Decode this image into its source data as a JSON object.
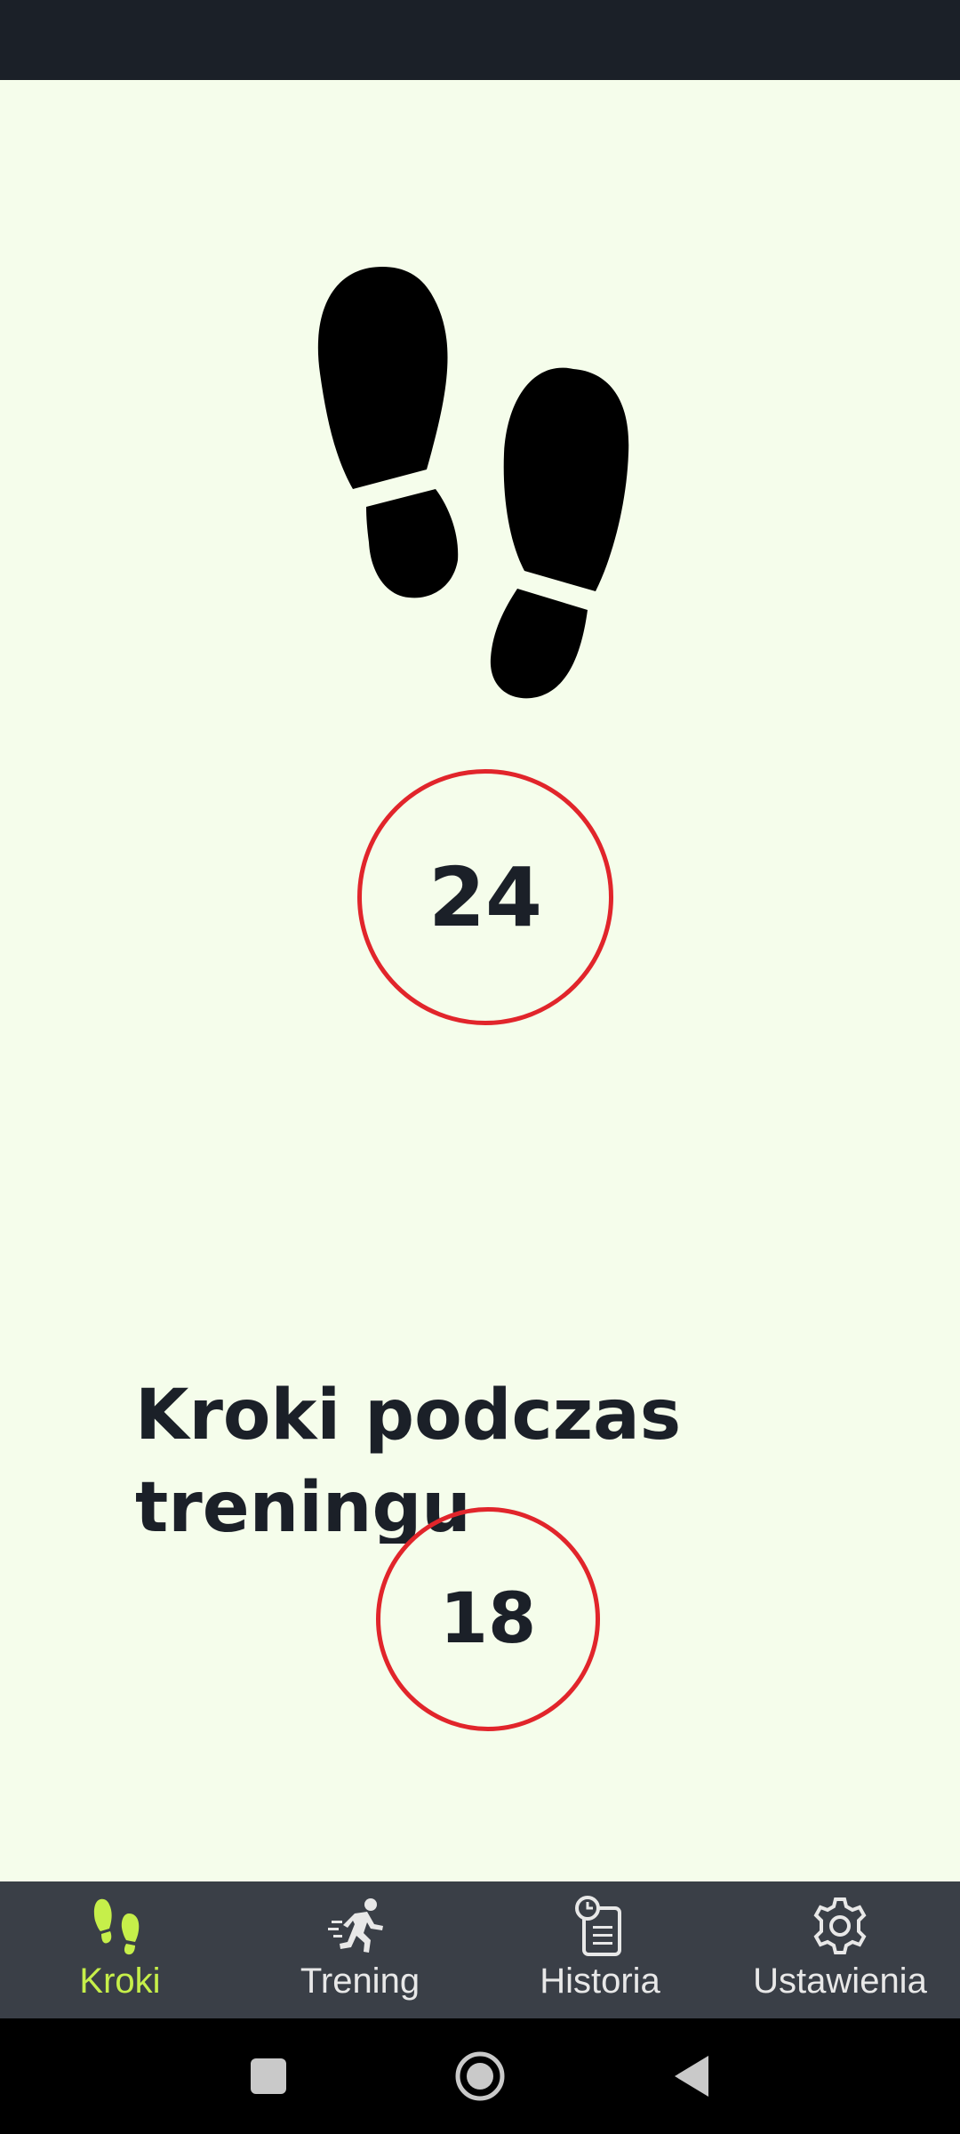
{
  "steps": {
    "total_count": "24",
    "training_title": "Kroki podczas\ntreningu",
    "training_count": "18"
  },
  "nav": {
    "items": [
      {
        "label": "Kroki",
        "icon": "footsteps-icon",
        "active": true
      },
      {
        "label": "Trening",
        "icon": "running-person-icon",
        "active": false
      },
      {
        "label": "Historia",
        "icon": "history-clipboard-icon",
        "active": false
      },
      {
        "label": "Ustawienia",
        "icon": "gear-icon",
        "active": false
      }
    ]
  },
  "system_nav": {
    "buttons": [
      "recents-button",
      "home-button",
      "back-button"
    ]
  },
  "colors": {
    "background": "#f5fdeb",
    "status_bar": "#1b2028",
    "bottom_nav": "#3a3f47",
    "accent": "#c6ef4a",
    "circle_border": "#e1252b",
    "text": "#1b2028"
  }
}
